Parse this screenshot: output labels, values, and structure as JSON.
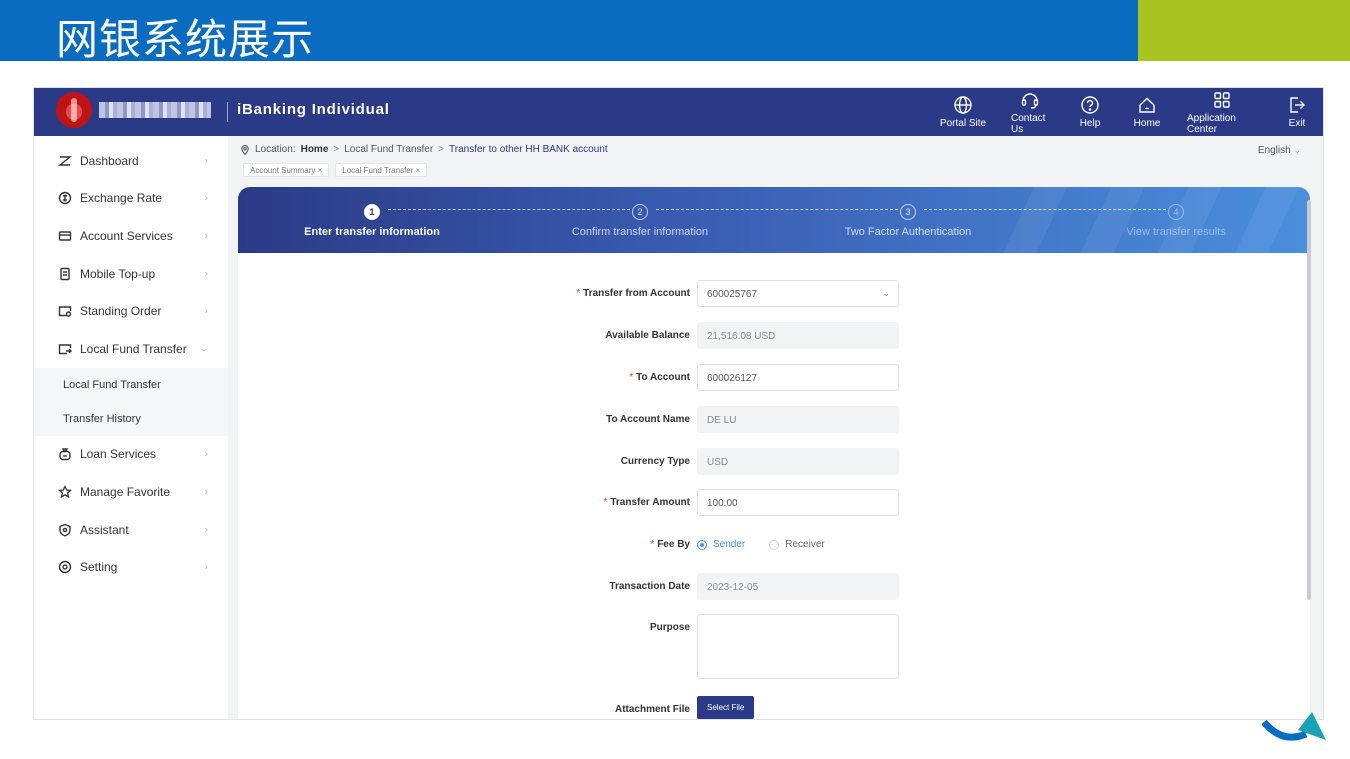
{
  "banner": {
    "title": "网银系统展示",
    "colors": {
      "primary": "#0a6cc0",
      "accent": "#a9c420"
    }
  },
  "app": {
    "product_name": "iBanking Individual",
    "brand_color": "#2b3a86",
    "top_nav": [
      {
        "label": "Portal Site",
        "icon": "globe-icon"
      },
      {
        "label": "Contact Us",
        "icon": "headset-icon"
      },
      {
        "label": "Help",
        "icon": "help-icon"
      },
      {
        "label": "Home",
        "icon": "home-icon"
      },
      {
        "label": "Application Center",
        "icon": "grid-icon"
      },
      {
        "label": "Exit",
        "icon": "exit-icon"
      }
    ]
  },
  "sidebar": {
    "items": [
      {
        "label": "Dashboard",
        "icon": "dashboard-icon",
        "chevron": "›"
      },
      {
        "label": "Exchange Rate",
        "icon": "exchange-icon",
        "chevron": "›"
      },
      {
        "label": "Account Services",
        "icon": "card-icon",
        "chevron": "›"
      },
      {
        "label": "Mobile Top-up",
        "icon": "phone-icon",
        "chevron": "›"
      },
      {
        "label": "Standing Order",
        "icon": "calendar-icon",
        "chevron": "›"
      },
      {
        "label": "Local Fund Transfer",
        "icon": "transfer-icon",
        "chevron": "⌄"
      },
      {
        "label": "Loan Services",
        "icon": "moneybag-icon",
        "chevron": "›"
      },
      {
        "label": "Manage Favorite",
        "icon": "star-icon",
        "chevron": "›"
      },
      {
        "label": "Assistant",
        "icon": "shield-icon",
        "chevron": "›"
      },
      {
        "label": "Setting",
        "icon": "gear-icon",
        "chevron": "›"
      }
    ],
    "submenu": [
      "Local Fund Transfer",
      "Transfer History"
    ]
  },
  "breadcrumb": {
    "prefix": "Location:",
    "home": "Home",
    "sep": ">",
    "level1": "Local Fund Transfer",
    "current": "Transfer to other HH BANK account"
  },
  "language": "English",
  "tags": [
    {
      "label": "Account Summary",
      "close": "×"
    },
    {
      "label": "Local Fund Transfer",
      "close": "×"
    }
  ],
  "steps": [
    {
      "num": "1",
      "label": "Enter transfer information"
    },
    {
      "num": "2",
      "label": "Confirm transfer information"
    },
    {
      "num": "3",
      "label": "Two Factor Authentication"
    },
    {
      "num": "4",
      "label": "View transfer results"
    }
  ],
  "form": {
    "required_mark": "*",
    "from_account": {
      "label": "Transfer from Account",
      "value": "600025767"
    },
    "available_balance": {
      "label": "Available Balance",
      "value": "21,516.08 USD"
    },
    "to_account": {
      "label": "To Account",
      "value": "600026127"
    },
    "to_account_name": {
      "label": "To Account Name",
      "value": "DE LU"
    },
    "currency_type": {
      "label": "Currency Type",
      "value": "USD"
    },
    "transfer_amount": {
      "label": "Transfer Amount",
      "value": "100.00"
    },
    "fee_by": {
      "label": "Fee By",
      "options": [
        "Sender",
        "Receiver"
      ],
      "selected": "Sender"
    },
    "transaction_date": {
      "label": "Transaction Date",
      "value": "2023-12-05"
    },
    "purpose": {
      "label": "Purpose",
      "value": ""
    },
    "attachment": {
      "label": "Attachment File",
      "button": "Select File"
    }
  }
}
